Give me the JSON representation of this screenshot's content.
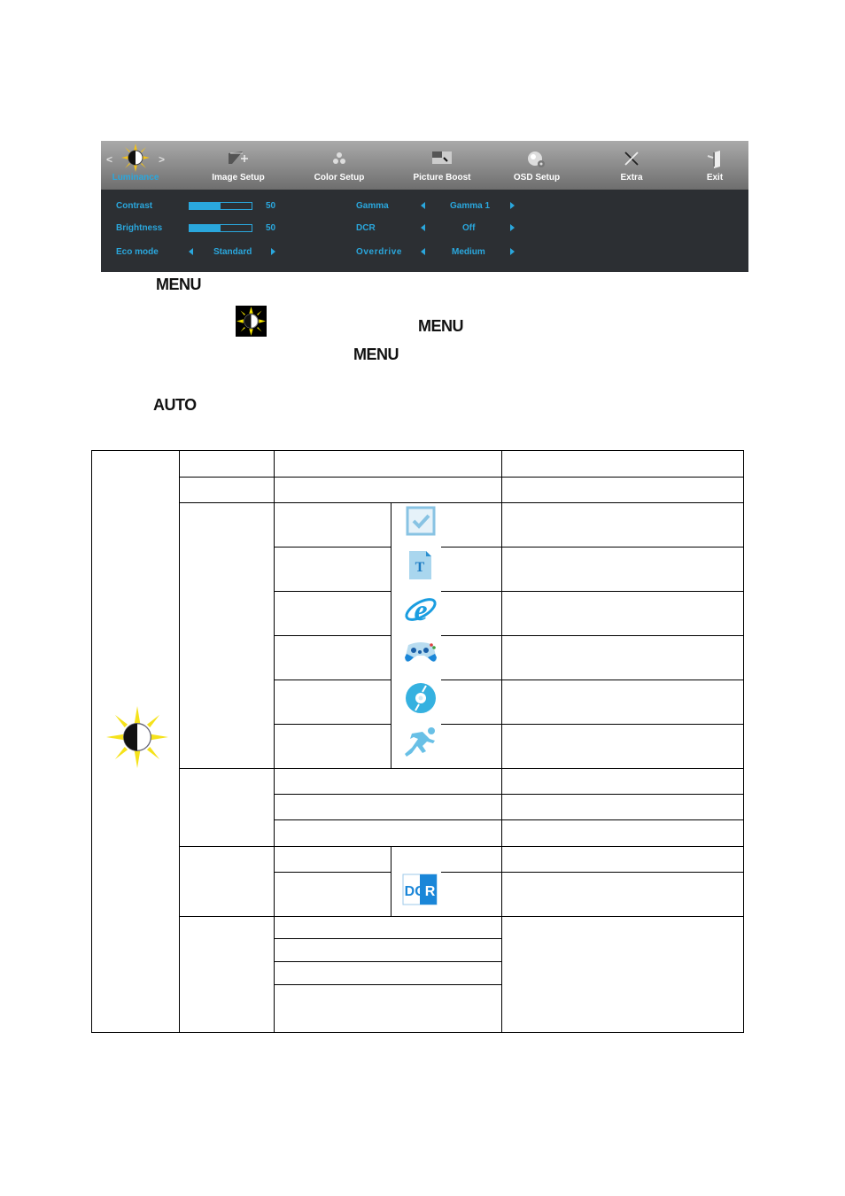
{
  "osd": {
    "tabs": [
      {
        "label": "Luminance",
        "icon": "luminance-icon",
        "active": true
      },
      {
        "label": "Image Setup",
        "icon": "image-setup-icon",
        "active": false
      },
      {
        "label": "Color Setup",
        "icon": "color-setup-icon",
        "active": false
      },
      {
        "label": "Picture Boost",
        "icon": "picture-boost-icon",
        "active": false
      },
      {
        "label": "OSD Setup",
        "icon": "osd-setup-icon",
        "active": false
      },
      {
        "label": "Extra",
        "icon": "extra-icon",
        "active": false
      },
      {
        "label": "Exit",
        "icon": "exit-icon",
        "active": false
      }
    ],
    "nav_prev": "<",
    "nav_next": ">",
    "settings": {
      "contrast": {
        "label": "Contrast",
        "value": "50",
        "fraction": 0.5
      },
      "brightness": {
        "label": "Brightness",
        "value": "50",
        "fraction": 0.5
      },
      "eco_mode": {
        "label": "Eco mode",
        "value": "Standard"
      },
      "gamma": {
        "label": "Gamma",
        "value": "Gamma 1"
      },
      "dcr": {
        "label": "DCR",
        "value": "Off"
      },
      "overdrive": {
        "label": "Overdrive",
        "value": "Medium"
      }
    },
    "colors": {
      "accent": "#2aa7dd",
      "panel": "#2c2f33",
      "header_top": "#a9a9a9",
      "header_bottom": "#6e6e6e"
    }
  },
  "instructions": {
    "step1_key": "MENU",
    "step2_key": "MENU",
    "step3_key": "MENU",
    "step4_key": "AUTO"
  },
  "table": {
    "icons": [
      "luminance-icon",
      "checkbox-icon",
      "text-document-icon",
      "internet-explorer-icon",
      "gamepad-icon",
      "disc-icon",
      "running-man-icon",
      "dcr-icon"
    ]
  }
}
